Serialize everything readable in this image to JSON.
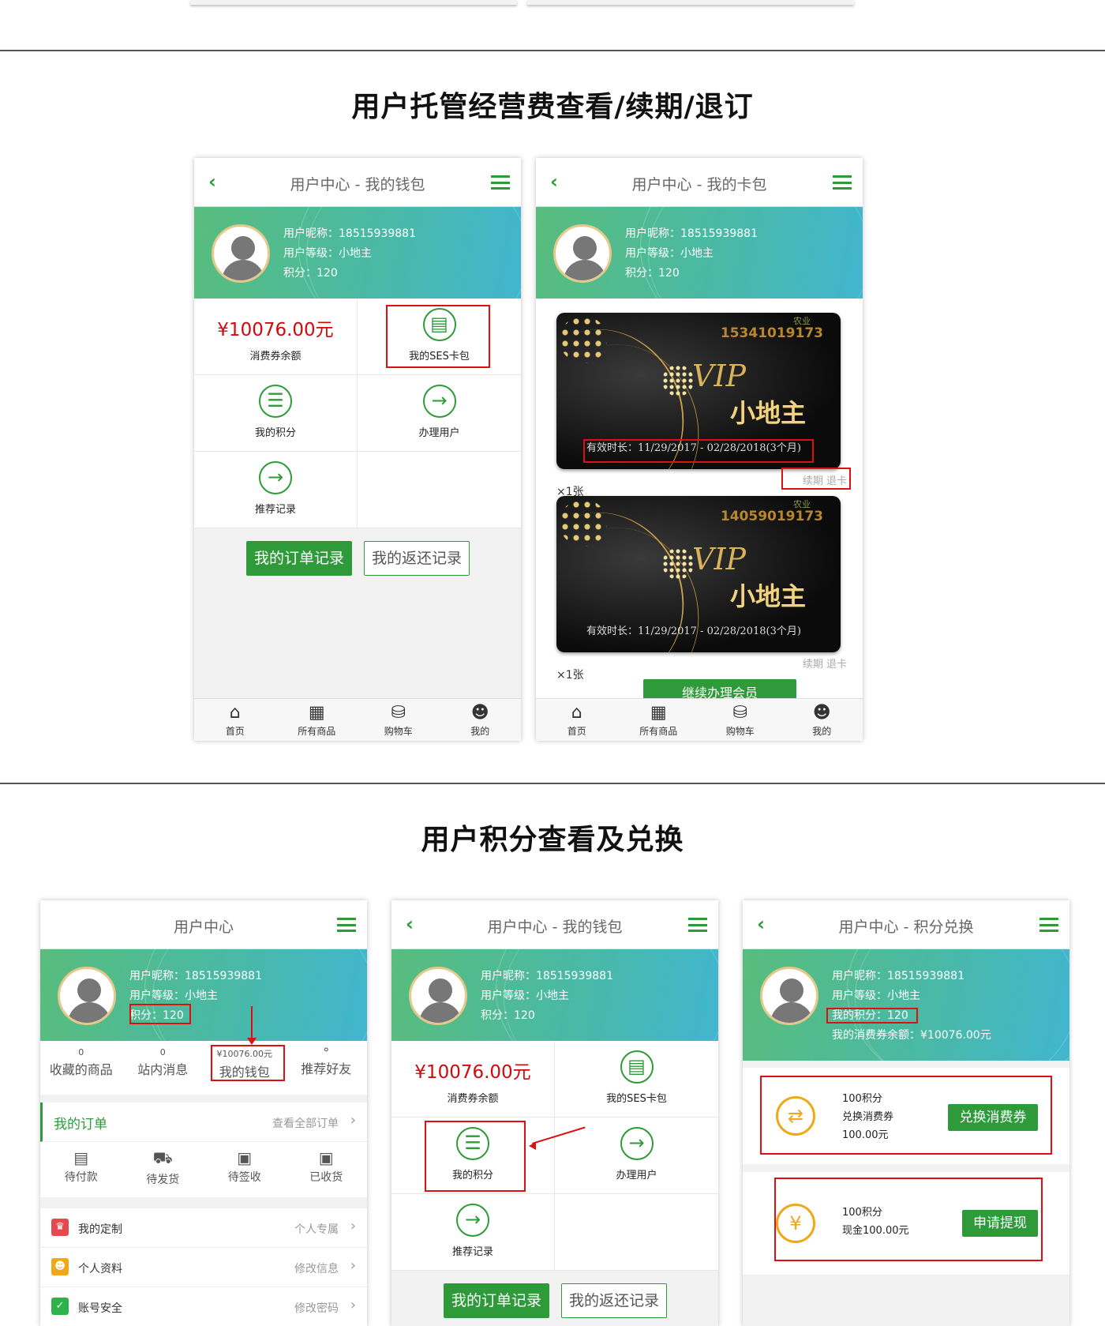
{
  "top_phones_tab_labels_hint": "",
  "section1": {
    "title": "用户托管经营费查看/续期/退订"
  },
  "section2": {
    "title": "用户积分查看及兑换"
  },
  "user": {
    "nickname": "用户昵称：18515939881",
    "level": "用户等级：小地主",
    "points": "积分：120",
    "points_mine": "我的积分：120",
    "voucher_balance": "我的消费券余额：¥10076.00元"
  },
  "wallet": {
    "title": "用户中心 - 我的钱包",
    "balance": "¥10076.00元",
    "balance_label": "消费券余额",
    "ses_card": "我的SES卡包",
    "my_points": "我的积分",
    "handle_user": "办理用户",
    "referral": "推荐记录",
    "orders_btn": "我的订单记录",
    "refund_btn": "我的返还记录"
  },
  "cardpack": {
    "title": "用户中心 - 我的卡包",
    "cards": [
      {
        "number": "15341019173",
        "logo": "农业",
        "vip": "VIP",
        "rank": "小地主",
        "valid": "有效时长：11/29/2017 - 02/28/2018(3个月)",
        "renew": "续期 退卡",
        "qty": "×1张"
      },
      {
        "number": "14059019173",
        "logo": "农业",
        "vip": "VIP",
        "rank": "小地主",
        "valid": "有效时长：11/29/2017 - 02/28/2018(3个月)",
        "renew": "续期 退卡",
        "qty": "×1张"
      }
    ],
    "continue_btn": "继续办理会员"
  },
  "tabs": [
    "首页",
    "所有商品",
    "购物车",
    "我的"
  ],
  "usercenter": {
    "title": "用户中心",
    "stats": [
      {
        "n": "0",
        "t": "收藏的商品"
      },
      {
        "n": "0",
        "t": "站内消息"
      },
      {
        "n": "¥10076.00元",
        "t": "我的钱包"
      },
      {
        "n": "",
        "t": "推荐好友"
      }
    ],
    "orders_title": "我的订单",
    "orders_all": "查看全部订单",
    "order_states": [
      "待付款",
      "待发货",
      "待签收",
      "已收货"
    ],
    "list": [
      {
        "l": "我的定制",
        "r": "个人专属"
      },
      {
        "l": "个人资料",
        "r": "修改信息"
      },
      {
        "l": "账号安全",
        "r": "修改密码"
      }
    ]
  },
  "exchange": {
    "title": "用户中心 - 积分兑换",
    "item1_l1": "100积分",
    "item1_l2": "兑换消费券",
    "item1_l3": "100.00元",
    "item1_btn": "兑换消费券",
    "item2_l1": "100积分",
    "item2_l2": "现金100.00元",
    "item2_btn": "申请提现"
  },
  "colors": {
    "accent": "#2e9a3a",
    "price": "#d1090b",
    "highlight": "#dd1111",
    "coin": "#f0a818"
  }
}
